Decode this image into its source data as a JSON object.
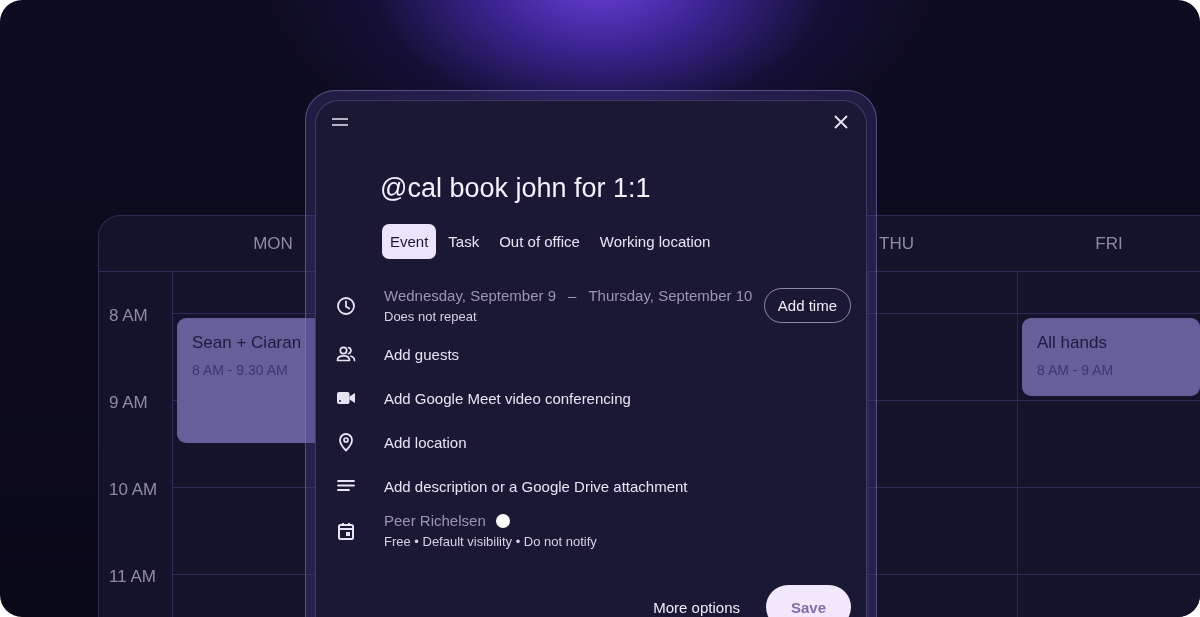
{
  "calendar": {
    "times": [
      "8 AM",
      "9 AM",
      "10 AM",
      "11 AM"
    ],
    "days": [
      {
        "label": "MON",
        "events": [
          {
            "title": "Sean + Ciaran",
            "time": "8 AM - 9.30 AM"
          }
        ]
      },
      {
        "label": "THU"
      },
      {
        "label": "FRI",
        "events": [
          {
            "title": "All hands",
            "time": "8 AM - 9 AM"
          }
        ]
      }
    ]
  },
  "dialog": {
    "title": "@cal book john for 1:1",
    "tabs": [
      {
        "label": "Event",
        "selected": true
      },
      {
        "label": "Task",
        "selected": false
      },
      {
        "label": "Out of office",
        "selected": false
      },
      {
        "label": "Working location",
        "selected": false
      }
    ],
    "date": {
      "start": "Wednesday, September 9",
      "separator": "–",
      "end": "Thursday, September 10",
      "repeat": "Does not repeat",
      "button": "Add time"
    },
    "options": [
      {
        "kind": "guests",
        "label": "Add guests"
      },
      {
        "kind": "video",
        "label": "Add Google Meet video conferencing"
      },
      {
        "kind": "location",
        "label": "Add location"
      },
      {
        "kind": "description",
        "label": "Add description or a Google Drive attachment"
      }
    ],
    "calendar": {
      "owner": "Peer Richelsen",
      "color": "#ffffff",
      "details": "Free • Default visibility • Do not notify"
    },
    "actions": {
      "more": "More options",
      "save": "Save"
    }
  }
}
